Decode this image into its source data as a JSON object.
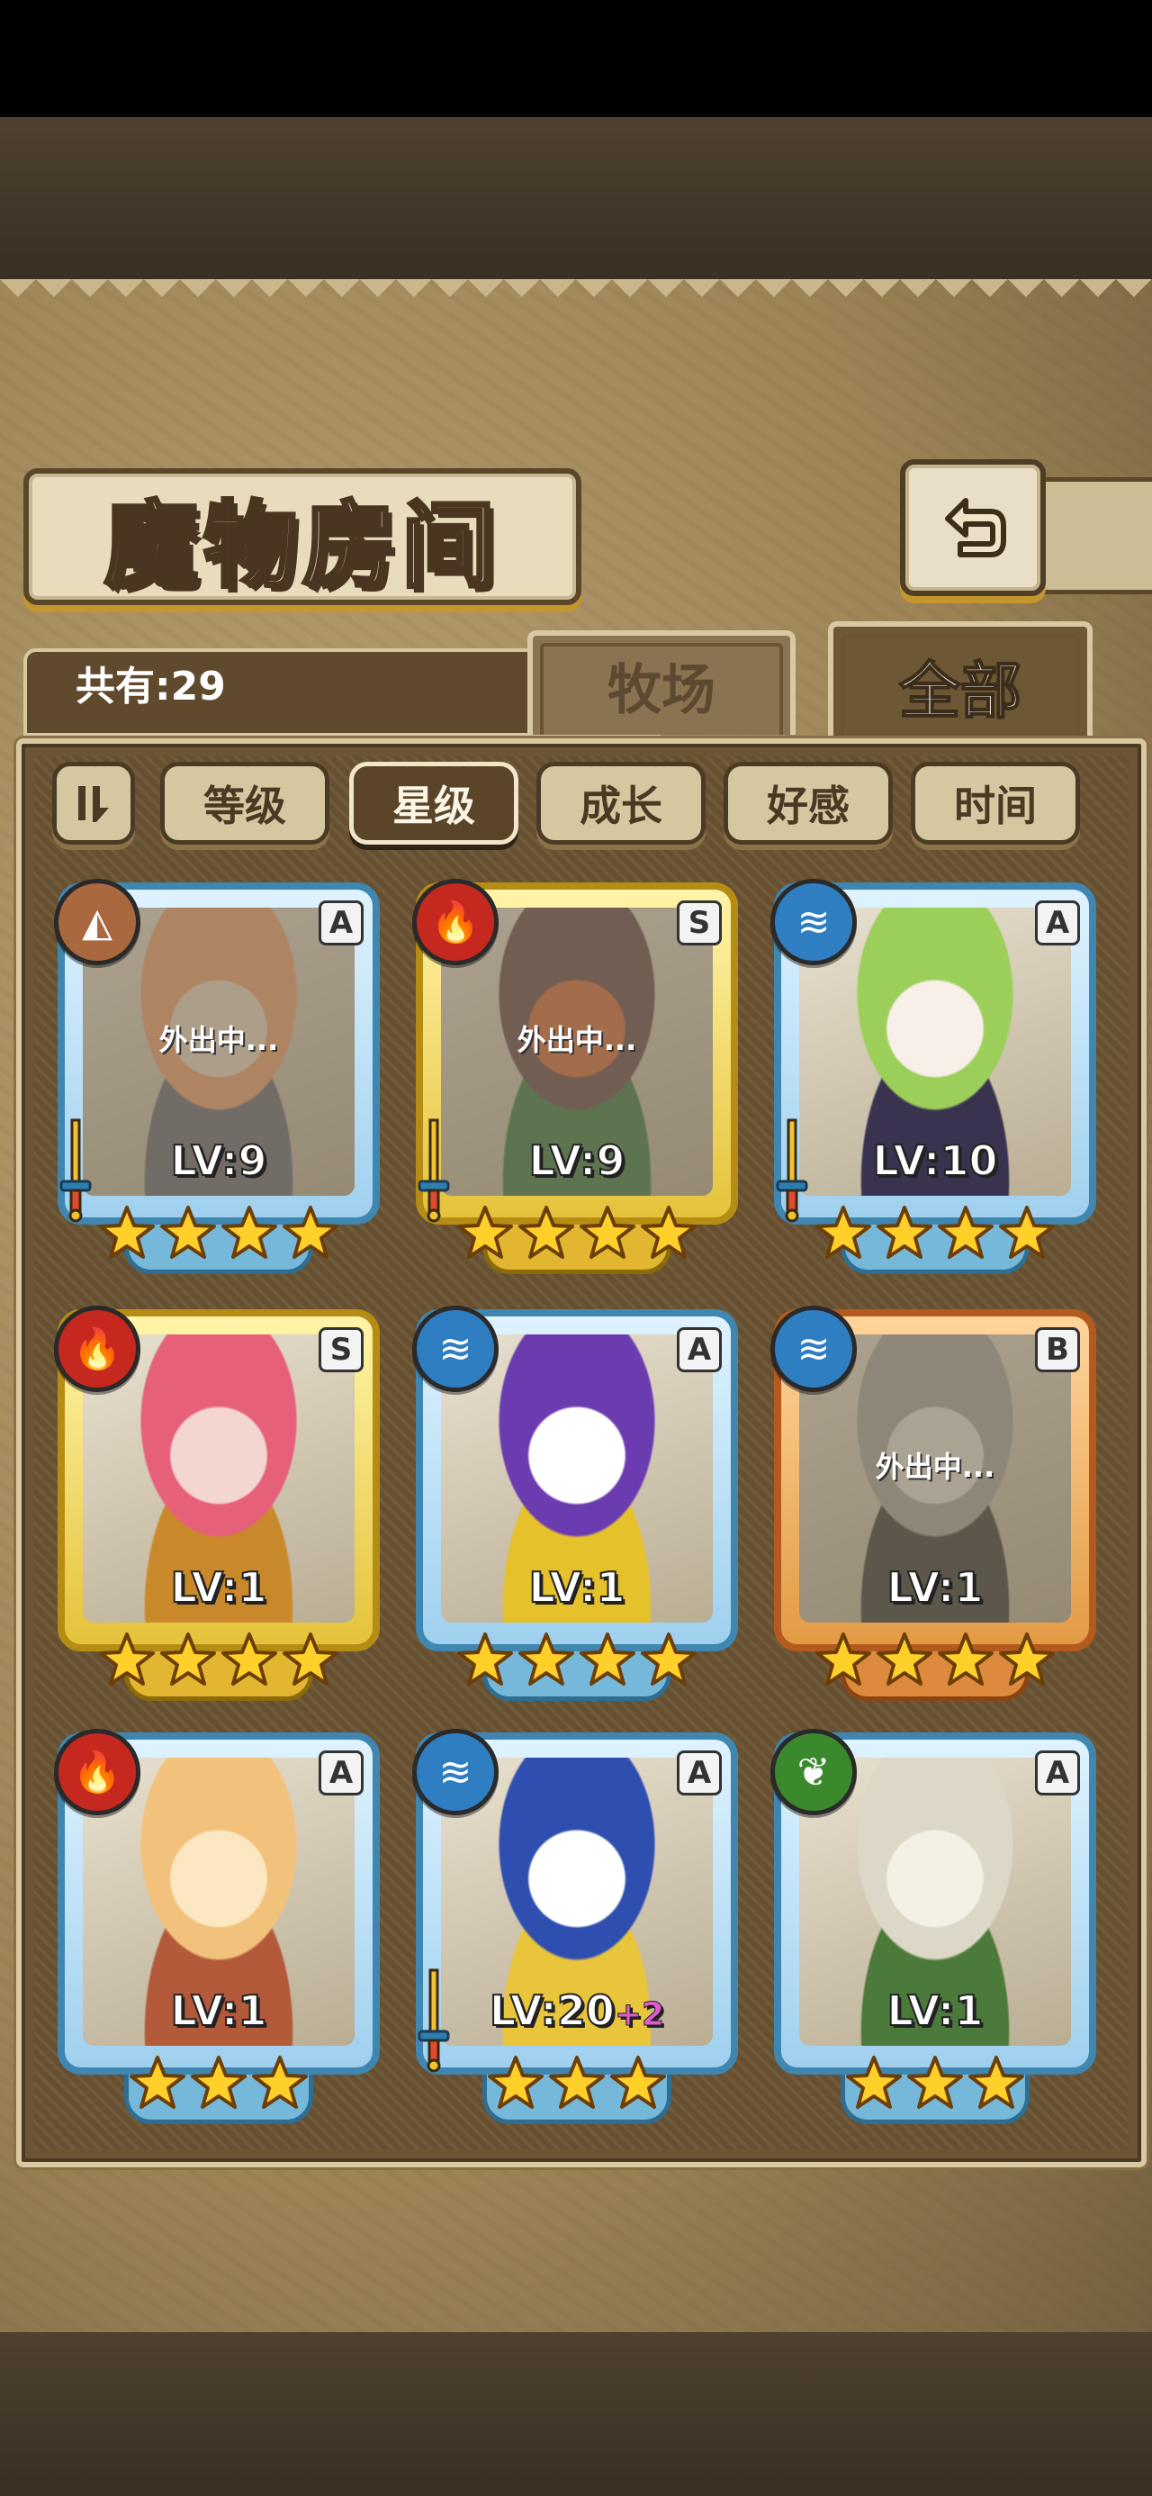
{
  "header": {
    "title": "魔物房间"
  },
  "back_button": {
    "icon": "back-arrow-icon"
  },
  "count": {
    "label": "共有:29"
  },
  "top_tabs": [
    {
      "label": "牧场",
      "active": false
    },
    {
      "label": "全部",
      "active": true
    }
  ],
  "sort": {
    "toggle_icon": "sort-order-icon",
    "buttons": [
      {
        "label": "等级",
        "active": false
      },
      {
        "label": "星级",
        "active": true
      },
      {
        "label": "成长",
        "active": false
      },
      {
        "label": "好感",
        "active": false
      },
      {
        "label": "时间",
        "active": false
      }
    ]
  },
  "monsters": [
    {
      "element": "earth",
      "rank": "A",
      "level": "LV:9",
      "plus": "",
      "stars": 4,
      "status": "外出中...",
      "frame": "blue",
      "equipped": true,
      "art": [
        "#f1a06f",
        "#ecd9c4",
        "#6a6a77"
      ]
    },
    {
      "element": "fire",
      "rank": "S",
      "level": "LV:9",
      "plus": "",
      "stars": 4,
      "status": "外出中...",
      "frame": "gold",
      "equipped": true,
      "art": [
        "#6b4a4a",
        "#d86b3a",
        "#3f7d45"
      ]
    },
    {
      "element": "water",
      "rank": "A",
      "level": "LV:10",
      "plus": "",
      "stars": 4,
      "status": "",
      "frame": "blue",
      "equipped": true,
      "art": [
        "#9ccf5a",
        "#f7efe8",
        "#3a3350"
      ]
    },
    {
      "element": "fire",
      "rank": "S",
      "level": "LV:1",
      "plus": "",
      "stars": 4,
      "status": "",
      "frame": "gold",
      "equipped": false,
      "art": [
        "#e6607a",
        "#f3d6d0",
        "#c9892a"
      ]
    },
    {
      "element": "water",
      "rank": "A",
      "level": "LV:1",
      "plus": "",
      "stars": 4,
      "status": "",
      "frame": "blue",
      "equipped": false,
      "art": [
        "#6b3bb0",
        "#ffffff",
        "#e5c12b"
      ]
    },
    {
      "element": "water",
      "rank": "B",
      "level": "LV:1",
      "plus": "",
      "stars": 4,
      "status": "外出中...",
      "frame": "orange",
      "equipped": false,
      "art": [
        "#a8a6a0",
        "#e7e2d8",
        "#3a3a3a"
      ]
    },
    {
      "element": "fire",
      "rank": "A",
      "level": "LV:1",
      "plus": "",
      "stars": 3,
      "status": "",
      "frame": "blue",
      "equipped": false,
      "art": [
        "#f2c27c",
        "#fbe7c2",
        "#b25a3a"
      ]
    },
    {
      "element": "water",
      "rank": "A",
      "level": "LV:20",
      "plus": "+2",
      "stars": 3,
      "status": "",
      "frame": "blue",
      "equipped": true,
      "art": [
        "#2f4fb0",
        "#ffffff",
        "#e8c53a"
      ]
    },
    {
      "element": "wood",
      "rank": "A",
      "level": "LV:1",
      "plus": "",
      "stars": 3,
      "status": "",
      "frame": "blue",
      "equipped": false,
      "art": [
        "#dcd7c6",
        "#f4f0e6",
        "#4c7a3a"
      ]
    }
  ]
}
